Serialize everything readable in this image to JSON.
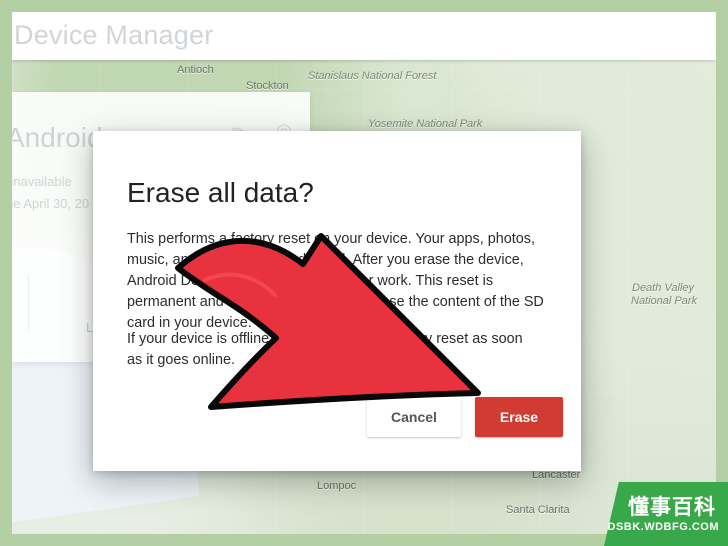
{
  "app": {
    "title": "Device Manager"
  },
  "device_card": {
    "name": "Android",
    "status": "unavailable",
    "date": "ne April 30, 20",
    "lock_label": "Lo"
  },
  "map": {
    "labels": [
      "Antioch",
      "Stockton",
      "Stanislaus National Forest",
      "Yosemite National Park",
      "Death Valley",
      "National Park",
      "Lancaster",
      "Lompoc",
      "Santa Clarita"
    ]
  },
  "dialog": {
    "title": "Erase all data?",
    "body": "This performs a factory reset on your device. Your apps, photos,\nmusic, and settings will be deleted. After you erase the device,\nAndroid Device Manager will no longer work. This reset is\npermanent and we can not be able to erase the content of the SD\ncard in your device.",
    "note": "If your device is offline, we will perform a factory reset as soon\nas it goes online.",
    "cancel_label": "Cancel",
    "erase_label": "Erase"
  },
  "watermark": {
    "title": "懂事百科",
    "url": "DSBK.WDBFG.COM"
  },
  "colors": {
    "arrow": "#e8333f",
    "erase_button": "#d13b31",
    "watermark": "#39a84a"
  },
  "icons": {
    "pencil": "pencil-icon",
    "target": "target-icon",
    "lock": "lock-icon",
    "arrow": "red-arrow-icon"
  }
}
